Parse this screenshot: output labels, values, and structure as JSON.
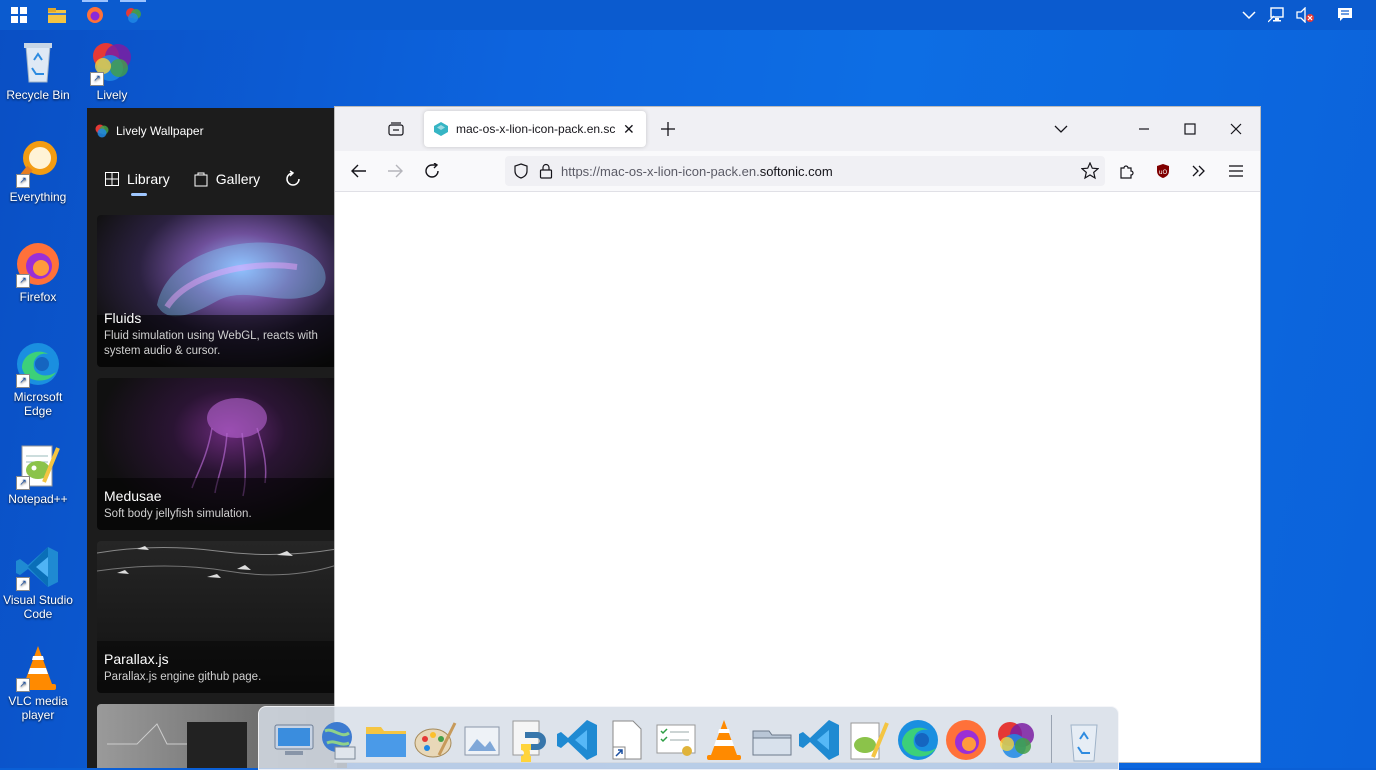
{
  "taskbar": {
    "items": [
      {
        "name": "start-button"
      },
      {
        "name": "file-explorer"
      },
      {
        "name": "firefox"
      },
      {
        "name": "lively-wallpaper"
      }
    ]
  },
  "desktop": {
    "icons": [
      {
        "label": "Recycle Bin"
      },
      {
        "label": "Lively"
      },
      {
        "label": "Everything"
      },
      {
        "label": "Firefox"
      },
      {
        "label": "Microsoft Edge"
      },
      {
        "label": "Notepad++"
      },
      {
        "label": "Visual Studio Code"
      },
      {
        "label": "VLC media player"
      }
    ]
  },
  "lively": {
    "title": "Lively Wallpaper",
    "nav": {
      "library": "Library",
      "gallery": "Gallery"
    },
    "cards": [
      {
        "title": "Fluids",
        "desc": "Fluid simulation using WebGL, reacts with system audio & cursor."
      },
      {
        "title": "Medusae",
        "desc": "Soft body jellyfish simulation."
      },
      {
        "title": "Parallax.js",
        "desc": "Parallax.js engine github page."
      }
    ]
  },
  "firefox": {
    "tab_title": "mac-os-x-lion-icon-pack.en.sc",
    "url_prefix": "https://mac-os-x-lion-icon-pack.en.",
    "url_domain": "softonic.com"
  },
  "colors": {
    "desktop": "#0b62da",
    "lively_bg": "#1c1c1c",
    "ff_tabbar": "#f0f0f4"
  }
}
